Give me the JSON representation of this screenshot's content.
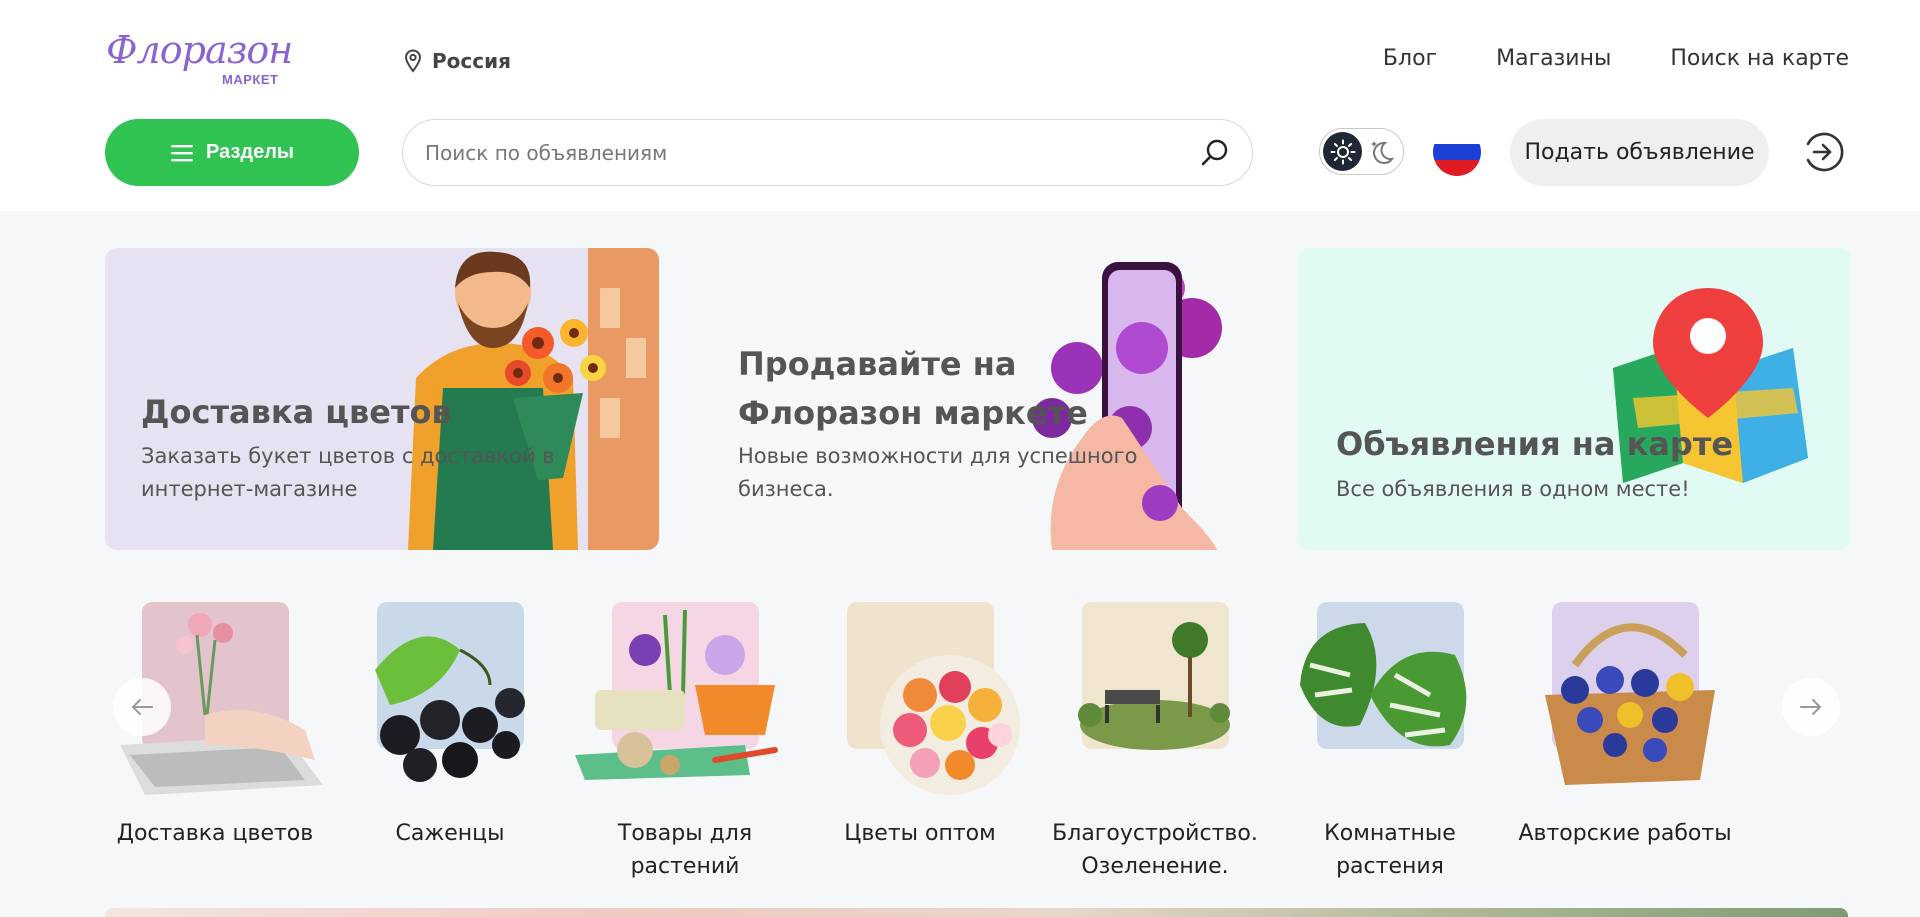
{
  "header": {
    "logo_script": "Флоразон",
    "logo_sub": "МАРКЕТ",
    "region": "Россия",
    "nav": [
      "Блог",
      "Магазины",
      "Поиск на карте"
    ],
    "sections_label": "Разделы",
    "search_placeholder": "Поиск по объявлениям",
    "post_label": "Подать объявление",
    "flag_colors": [
      "#ffffff",
      "#1c3fd6",
      "#e01b24"
    ],
    "accent": "#31c352",
    "brand": "#8a63d2"
  },
  "banners": [
    {
      "title": "Доставка цветов",
      "subtitle": "Заказать букет цветов с доставкой в интернет-магазине",
      "bg": "#e6e2f1"
    },
    {
      "title": "Продавайте на Флоразон маркете",
      "subtitle": "Новые возможности для успешного бизнеса.",
      "bg": "#f6f7f8"
    },
    {
      "title": "Объявления на карте",
      "subtitle": "Все объявления в одном месте!",
      "bg": "#e1faf3"
    }
  ],
  "categories": [
    {
      "label": "Доставка цветов",
      "icon": "laptop-bouquet-icon"
    },
    {
      "label": "Саженцы",
      "icon": "currant-icon"
    },
    {
      "label": "Товары для растений",
      "icon": "garden-supplies-icon"
    },
    {
      "label": "Цветы оптом",
      "icon": "flower-bouquet-icon"
    },
    {
      "label": "Благоустройство. Озеленение.",
      "icon": "park-bench-icon"
    },
    {
      "label": "Комнатные растения",
      "icon": "monstera-leaf-icon"
    },
    {
      "label": "Авторские работы",
      "icon": "gift-basket-icon"
    }
  ]
}
